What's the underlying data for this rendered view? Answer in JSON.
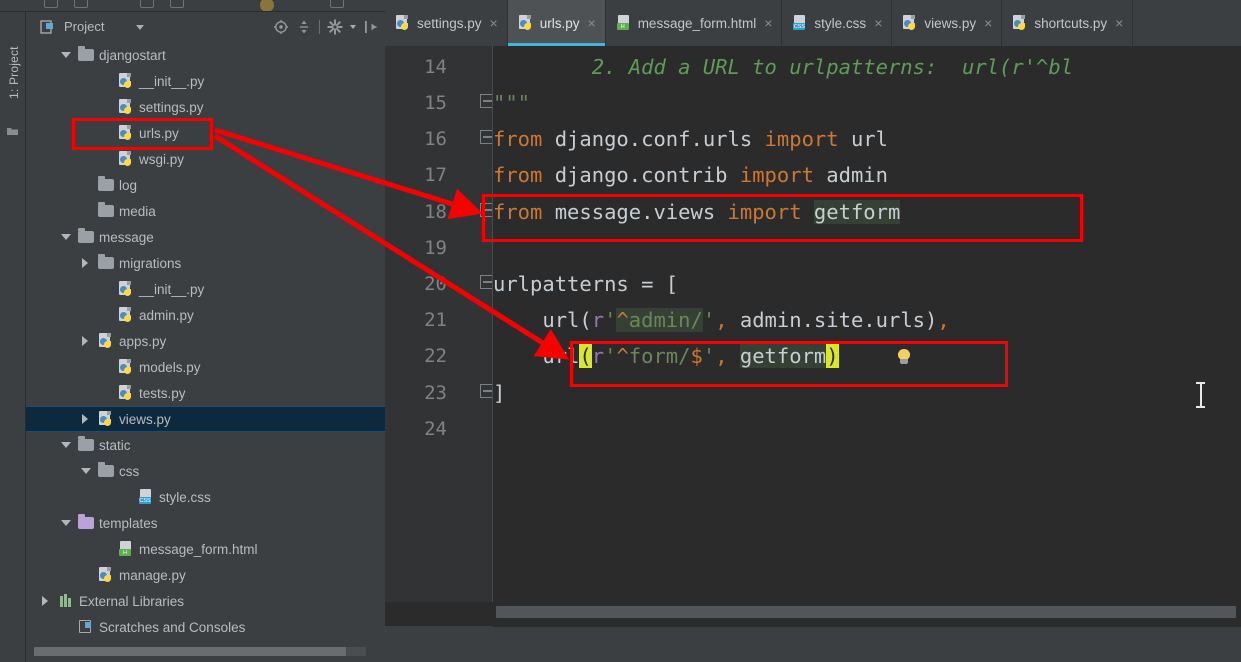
{
  "window": {
    "app": "PyCharm",
    "theme_accent": "#40b6e0",
    "annotation_color": "#f70000"
  },
  "tool_strip": {
    "label": "1: Project",
    "icon": "project-structure-icon"
  },
  "project_panel": {
    "title": "Project",
    "toolbar": [
      {
        "name": "locate-icon",
        "label": "Select Opened File"
      },
      {
        "name": "collapse-all-icon",
        "label": "Collapse All"
      },
      {
        "name": "settings-gear-icon",
        "label": "Settings"
      },
      {
        "name": "hide-panel-icon",
        "label": "Hide"
      }
    ],
    "tree": [
      {
        "label": "djangostart",
        "indent": 0,
        "twisty": "down",
        "icon": "folder-icon",
        "selected": false,
        "highlight": false
      },
      {
        "label": "__init__.py",
        "indent": 2,
        "twisty": "none",
        "icon": "python-file-icon",
        "selected": false,
        "highlight": false
      },
      {
        "label": "settings.py",
        "indent": 2,
        "twisty": "none",
        "icon": "python-file-icon",
        "selected": false,
        "highlight": false
      },
      {
        "label": "urls.py",
        "indent": 2,
        "twisty": "none",
        "icon": "python-file-icon",
        "selected": false,
        "highlight": true
      },
      {
        "label": "wsgi.py",
        "indent": 2,
        "twisty": "none",
        "icon": "python-file-icon",
        "selected": false,
        "highlight": false
      },
      {
        "label": "log",
        "indent": 1,
        "twisty": "none",
        "icon": "folder-icon",
        "selected": false,
        "highlight": false
      },
      {
        "label": "media",
        "indent": 1,
        "twisty": "none",
        "icon": "folder-icon",
        "selected": false,
        "highlight": false
      },
      {
        "label": "message",
        "indent": 0,
        "twisty": "down",
        "icon": "folder-icon",
        "selected": false,
        "highlight": false
      },
      {
        "label": "migrations",
        "indent": 1,
        "twisty": "right",
        "icon": "folder-icon",
        "selected": false,
        "highlight": false
      },
      {
        "label": "__init__.py",
        "indent": 2,
        "twisty": "none",
        "icon": "python-file-icon",
        "selected": false,
        "highlight": false
      },
      {
        "label": "admin.py",
        "indent": 2,
        "twisty": "none",
        "icon": "python-file-icon",
        "selected": false,
        "highlight": false
      },
      {
        "label": "apps.py",
        "indent": 1,
        "twisty": "right",
        "icon": "python-file-icon",
        "selected": false,
        "highlight": false
      },
      {
        "label": "models.py",
        "indent": 2,
        "twisty": "none",
        "icon": "python-file-icon",
        "selected": false,
        "highlight": false
      },
      {
        "label": "tests.py",
        "indent": 2,
        "twisty": "none",
        "icon": "python-file-icon",
        "selected": false,
        "highlight": false
      },
      {
        "label": "views.py",
        "indent": 1,
        "twisty": "right",
        "icon": "python-file-icon",
        "selected": true,
        "highlight": false
      },
      {
        "label": "static",
        "indent": 0,
        "twisty": "down",
        "icon": "folder-icon",
        "selected": false,
        "highlight": false
      },
      {
        "label": "css",
        "indent": 1,
        "twisty": "down",
        "icon": "folder-icon",
        "selected": false,
        "highlight": false
      },
      {
        "label": "style.css",
        "indent": 3,
        "twisty": "none",
        "icon": "css-file-icon",
        "selected": false,
        "highlight": false
      },
      {
        "label": "templates",
        "indent": 0,
        "twisty": "down",
        "icon": "folder-icon-purple",
        "selected": false,
        "highlight": false
      },
      {
        "label": "message_form.html",
        "indent": 2,
        "twisty": "none",
        "icon": "html-file-icon",
        "selected": false,
        "highlight": false
      },
      {
        "label": "manage.py",
        "indent": 1,
        "twisty": "none",
        "icon": "python-file-icon",
        "selected": false,
        "highlight": false
      },
      {
        "label": "External Libraries",
        "indent": -1,
        "twisty": "right",
        "icon": "libraries-icon",
        "selected": false,
        "highlight": false
      },
      {
        "label": "Scratches and Consoles",
        "indent": 0,
        "twisty": "none",
        "icon": "scratches-icon",
        "selected": false,
        "highlight": false
      }
    ]
  },
  "editor": {
    "tabs": [
      {
        "label": "settings.py",
        "icon": "python-file-icon",
        "active": false,
        "close": "×"
      },
      {
        "label": "urls.py",
        "icon": "python-file-icon",
        "active": true,
        "close": "×"
      },
      {
        "label": "message_form.html",
        "icon": "html-file-icon",
        "active": false,
        "close": "×"
      },
      {
        "label": "style.css",
        "icon": "css-file-icon",
        "active": false,
        "close": "×"
      },
      {
        "label": "views.py",
        "icon": "python-file-icon",
        "active": false,
        "close": "×"
      },
      {
        "label": "shortcuts.py",
        "icon": "python-file-icon",
        "active": false,
        "close": "×"
      }
    ],
    "first_visible_line": 14,
    "line_numbers": [
      "14",
      "15",
      "16",
      "17",
      "18",
      "19",
      "20",
      "21",
      "22",
      "23",
      "24"
    ],
    "lines": [
      {
        "n": "14",
        "text": "        2. Add a URL to urlpatterns:  url(r'^bl"
      },
      {
        "n": "15",
        "text": "\"\"\""
      },
      {
        "n": "16",
        "text": "from django.conf.urls import url"
      },
      {
        "n": "17",
        "text": "from django.contrib import admin"
      },
      {
        "n": "18",
        "text": "from message.views import getform"
      },
      {
        "n": "19",
        "text": ""
      },
      {
        "n": "20",
        "text": "urlpatterns = ["
      },
      {
        "n": "21",
        "text": "    url(r'^admin/', admin.site.urls),"
      },
      {
        "n": "22",
        "text": "    url(r'^form/$', getform)"
      },
      {
        "n": "23",
        "text": "]"
      },
      {
        "n": "24",
        "text": ""
      }
    ],
    "gutter_icon": "intention-bulb-icon",
    "mouse_cursor": "text-ibeam-cursor"
  },
  "annotations": {
    "boxes": [
      {
        "name": "urls-py-tree-highlight",
        "target": "urls.py"
      },
      {
        "name": "import-line-highlight",
        "target": "from message.views import getform"
      },
      {
        "name": "url-pattern-highlight",
        "target": "url(r'^form/$', getform)"
      }
    ],
    "arrows": [
      {
        "from": "urls.py (tree)",
        "to": "from message.views import getform"
      },
      {
        "from": "urls.py (tree)",
        "to": "url(r'^form/$', getform)"
      }
    ]
  }
}
